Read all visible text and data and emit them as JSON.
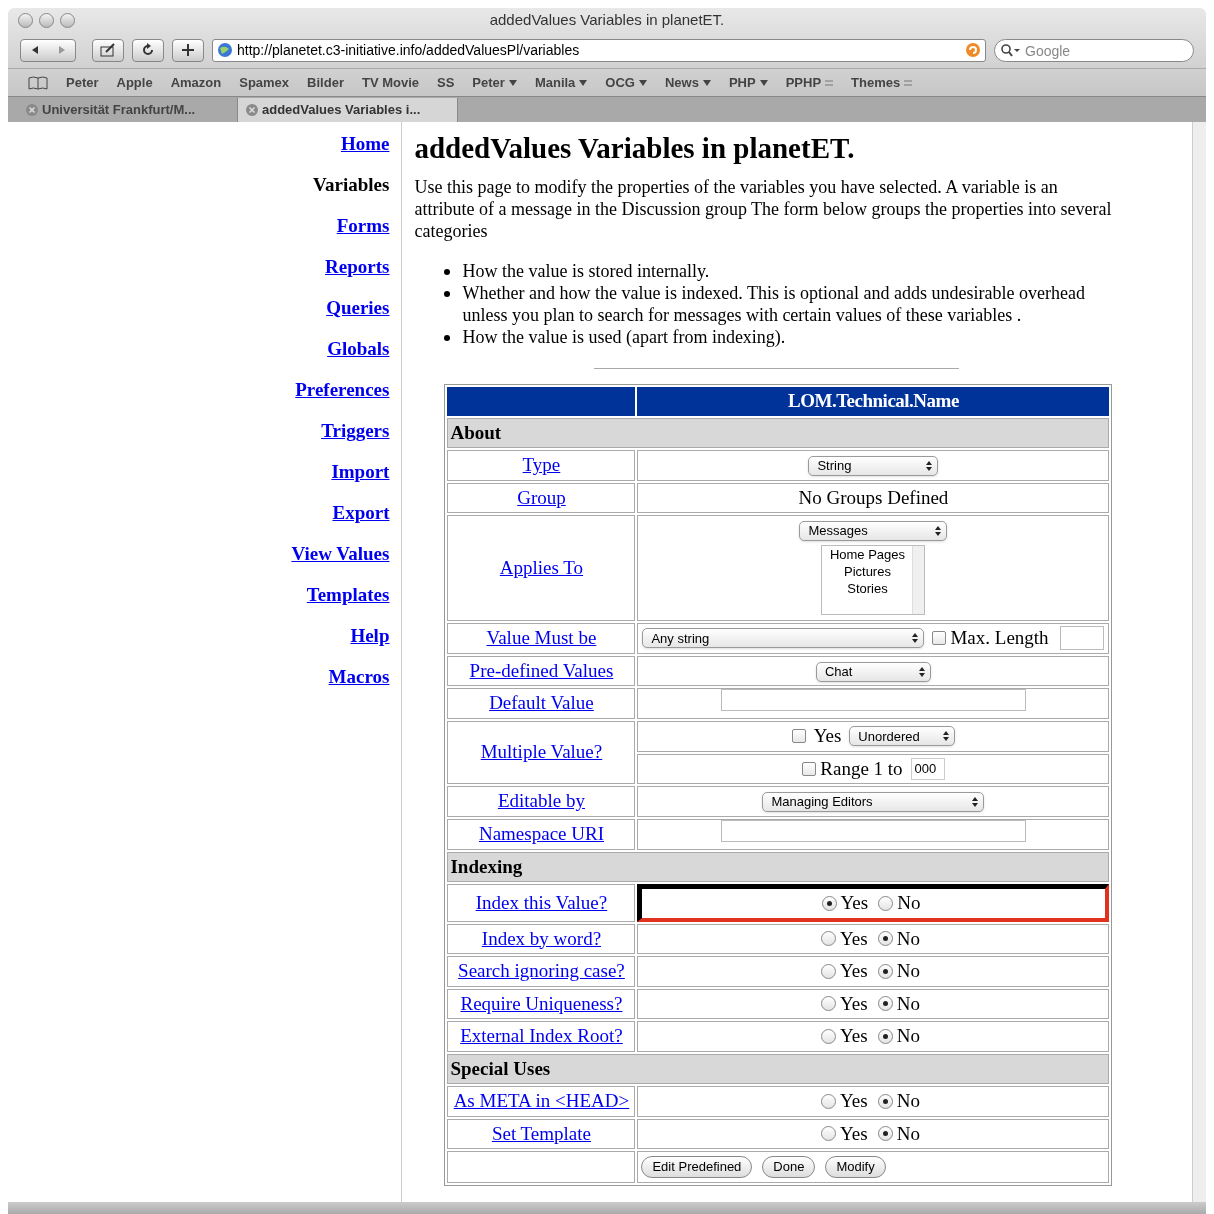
{
  "window": {
    "title": "addedValues Variables in planetET."
  },
  "toolbar": {
    "url": "http://planetet.c3-initiative.info/addedValuesPl/variables",
    "search_placeholder": "Google"
  },
  "bookmarks": [
    {
      "label": "Peter",
      "kind": "plain"
    },
    {
      "label": "Apple",
      "kind": "plain"
    },
    {
      "label": "Amazon",
      "kind": "plain"
    },
    {
      "label": "Spamex",
      "kind": "plain"
    },
    {
      "label": "Bilder",
      "kind": "plain"
    },
    {
      "label": "TV Movie",
      "kind": "plain"
    },
    {
      "label": "SS",
      "kind": "plain"
    },
    {
      "label": "Peter",
      "kind": "dropdown"
    },
    {
      "label": "Manila",
      "kind": "dropdown"
    },
    {
      "label": "OCG",
      "kind": "dropdown"
    },
    {
      "label": "News",
      "kind": "dropdown"
    },
    {
      "label": "PHP",
      "kind": "dropdown"
    },
    {
      "label": "PPHP",
      "kind": "list"
    },
    {
      "label": "Themes",
      "kind": "list"
    }
  ],
  "tabs": [
    {
      "label": "Universität Frankfurt/M...",
      "selected": false
    },
    {
      "label": "addedValues Variables i...",
      "selected": true
    }
  ],
  "sidebar": {
    "items": [
      {
        "label": "Home",
        "selected": false
      },
      {
        "label": "Variables",
        "selected": true
      },
      {
        "label": "Forms",
        "selected": false
      },
      {
        "label": "Reports",
        "selected": false
      },
      {
        "label": "Queries",
        "selected": false
      },
      {
        "label": "Globals",
        "selected": false
      },
      {
        "label": "Preferences",
        "selected": false
      },
      {
        "label": "Triggers",
        "selected": false
      },
      {
        "label": "Import",
        "selected": false
      },
      {
        "label": "Export",
        "selected": false
      },
      {
        "label": "View Values",
        "selected": false
      },
      {
        "label": "Templates",
        "selected": false
      },
      {
        "label": "Help",
        "selected": false
      },
      {
        "label": "Macros",
        "selected": false
      }
    ]
  },
  "page": {
    "heading": "addedValues Variables in planetET.",
    "intro": "Use this page to modify the properties of the variables you have selected. A variable is an attribute of a message in the Discussion group The form below groups the properties into several categories",
    "bullets": [
      "How the value is stored internally.",
      "Whether and how the value is indexed. This is optional and adds undesirable overhead unless you plan to search for messages with certain values of these variables .",
      "How the value is used (apart from indexing)."
    ]
  },
  "table": {
    "header": "LOM.Technical.Name",
    "rows": [
      {
        "kind": "section",
        "label": "About"
      },
      {
        "kind": "select",
        "label": "Type",
        "value": "String"
      },
      {
        "kind": "text",
        "label": "Group",
        "value": "No Groups Defined"
      },
      {
        "kind": "applies",
        "label": "Applies To",
        "value": "Messages",
        "options": [
          "Home Pages",
          "Pictures",
          "Stories"
        ]
      },
      {
        "kind": "constraint",
        "label": "Value Must be",
        "value": "Any string",
        "checkbox_label": "Max. Length",
        "checked": false
      },
      {
        "kind": "select",
        "label": "Pre-defined Values",
        "value": "Chat"
      },
      {
        "kind": "input",
        "label": "Default Value"
      },
      {
        "kind": "multiple",
        "label": "Multiple Value?",
        "yes_label": "Yes",
        "checked": false,
        "order": "Unordered",
        "range_label": "Range 1 to",
        "range_checked": false,
        "range_value": "000"
      },
      {
        "kind": "select",
        "label": "Editable by",
        "value": "Managing Editors"
      },
      {
        "kind": "input",
        "label": "Namespace URI"
      },
      {
        "kind": "section",
        "label": "Indexing"
      },
      {
        "kind": "radio",
        "label": "Index this Value?",
        "focused": true,
        "options": [
          {
            "label": "Yes",
            "selected": true
          },
          {
            "label": "No",
            "selected": false
          }
        ]
      },
      {
        "kind": "radio",
        "label": "Index by word?",
        "focused": false,
        "options": [
          {
            "label": "Yes",
            "selected": false
          },
          {
            "label": "No",
            "selected": true
          }
        ]
      },
      {
        "kind": "radio",
        "label": "Search ignoring case?",
        "focused": false,
        "options": [
          {
            "label": "Yes",
            "selected": false
          },
          {
            "label": "No",
            "selected": true
          }
        ]
      },
      {
        "kind": "radio",
        "label": "Require Uniqueness?",
        "focused": false,
        "options": [
          {
            "label": "Yes",
            "selected": false
          },
          {
            "label": "No",
            "selected": true
          }
        ]
      },
      {
        "kind": "radio",
        "label": "External Index Root?",
        "focused": false,
        "options": [
          {
            "label": "Yes",
            "selected": false
          },
          {
            "label": "No",
            "selected": true
          }
        ]
      },
      {
        "kind": "section",
        "label": "Special Uses"
      },
      {
        "kind": "radio",
        "label": "As META in <HEAD>",
        "focused": false,
        "options": [
          {
            "label": "Yes",
            "selected": false
          },
          {
            "label": "No",
            "selected": true
          }
        ]
      },
      {
        "kind": "radio",
        "label": "Set Template",
        "focused": false,
        "options": [
          {
            "label": "Yes",
            "selected": false
          },
          {
            "label": "No",
            "selected": true
          }
        ]
      },
      {
        "kind": "buttons",
        "buttons": [
          "Edit Predefined",
          "Done",
          "Modify"
        ]
      }
    ]
  }
}
